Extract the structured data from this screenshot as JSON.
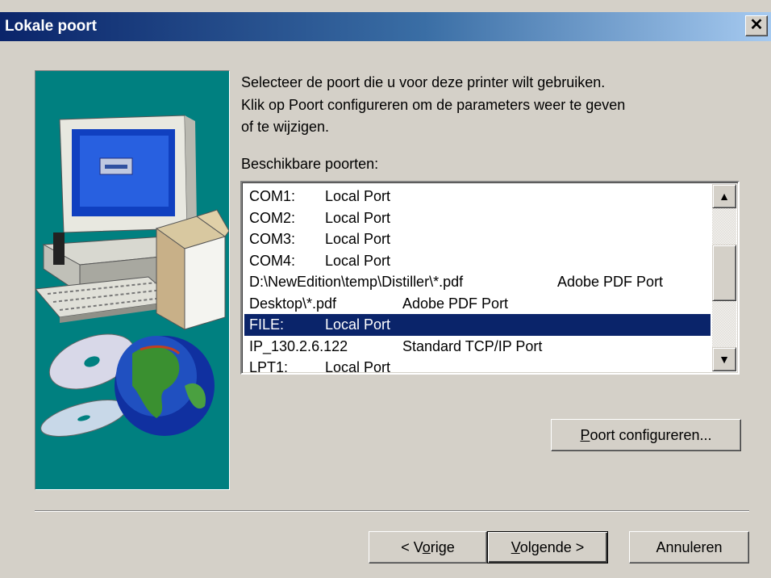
{
  "window": {
    "title": "Lokale poort",
    "close_glyph": "✕"
  },
  "intro": {
    "line1": "Selecteer de poort die u voor deze printer wilt gebruiken.",
    "line2": "Klik op Poort configureren om de parameters weer te geven",
    "line3": "of te wijzigen."
  },
  "ports_label": "Beschikbare poorten:",
  "ports": [
    {
      "name": "COM1:",
      "desc": "Local Port",
      "selected": false
    },
    {
      "name": "COM2:",
      "desc": "Local Port",
      "selected": false
    },
    {
      "name": "COM3:",
      "desc": "Local Port",
      "selected": false
    },
    {
      "name": "COM4:",
      "desc": "Local Port",
      "selected": false
    },
    {
      "name": "D:\\NewEdition\\temp\\Distiller\\*.pdf",
      "desc": "Adobe PDF Port",
      "selected": false
    },
    {
      "name": "Desktop\\*.pdf",
      "desc": "Adobe PDF Port",
      "selected": false
    },
    {
      "name": "FILE:",
      "desc": "Local Port",
      "selected": true
    },
    {
      "name": "IP_130.2.6.122",
      "desc": "Standard TCP/IP Port",
      "selected": false
    },
    {
      "name": "LPT1:",
      "desc": "Local Port",
      "selected": false
    }
  ],
  "buttons": {
    "configure": {
      "accel": "P",
      "rest": "oort configureren..."
    },
    "back": {
      "pre": "< V",
      "accel": "o",
      "rest": "rige"
    },
    "next": {
      "accel": "V",
      "rest": "olgende >"
    },
    "cancel": "Annuleren"
  },
  "icons": {
    "scroll_up": "▲",
    "scroll_down": "▼"
  },
  "colors": {
    "title_start": "#0a246a",
    "title_end": "#a6caf0",
    "illustration_bg": "#008080",
    "selection": "#0a246a"
  }
}
